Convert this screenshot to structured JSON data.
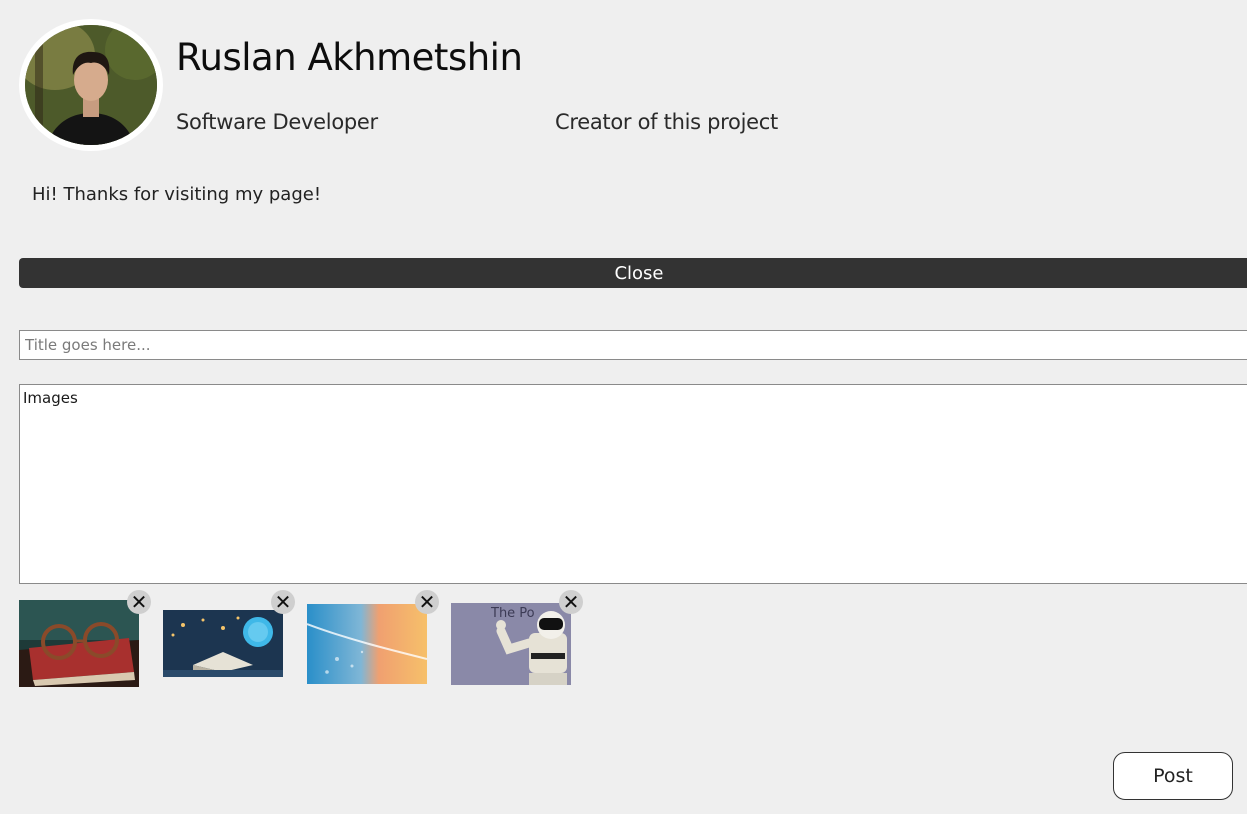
{
  "profile": {
    "name": "Ruslan Akhmetshin",
    "role": "Software Developer",
    "note": "Creator of this project",
    "bio": "Hi! Thanks for visiting my page!"
  },
  "close_label": "Close",
  "form": {
    "title_placeholder": "Title goes here...",
    "body_value": "Images",
    "post_label": "Post"
  },
  "thumbnails": [
    {
      "name": "glasses-on-book",
      "remove_icon": "close-icon"
    },
    {
      "name": "open-book-with-globe",
      "remove_icon": "close-icon"
    },
    {
      "name": "blue-orange-abstract",
      "remove_icon": "close-icon"
    },
    {
      "name": "robot-waving",
      "remove_icon": "close-icon",
      "overlay_text": "The Po"
    }
  ],
  "remove_glyph": "✕"
}
